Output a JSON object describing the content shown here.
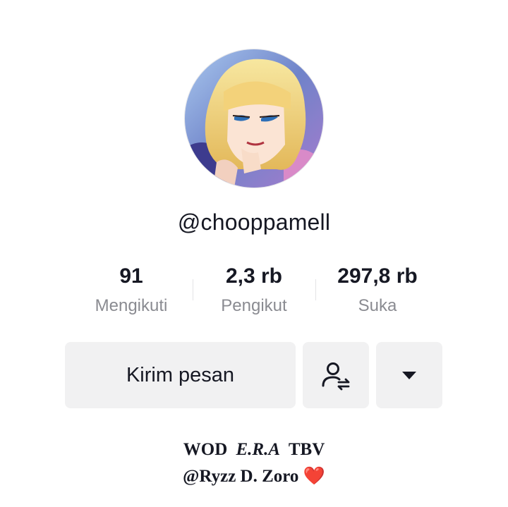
{
  "profile": {
    "username": "@chooppamell",
    "avatar_icon": "profile-avatar-illustration"
  },
  "stats": [
    {
      "value": "91",
      "label": "Mengikuti"
    },
    {
      "value": "2,3 rb",
      "label": "Pengikut"
    },
    {
      "value": "297,8 rb",
      "label": "Suka"
    }
  ],
  "actions": {
    "message_label": "Kirim pesan",
    "follow_icon": "user-swap-icon",
    "more_icon": "caret-down-icon"
  },
  "bio": {
    "line1_a": "WOD",
    "line1_b": "E.R.A",
    "line1_c": "TBV",
    "line2": "@Ryzz D. Zoro",
    "heart": "❤️"
  },
  "colors": {
    "text": "#161823",
    "secondary_text": "#8a8b91",
    "button_bg": "#f1f1f2",
    "heart": "#e0202a"
  }
}
